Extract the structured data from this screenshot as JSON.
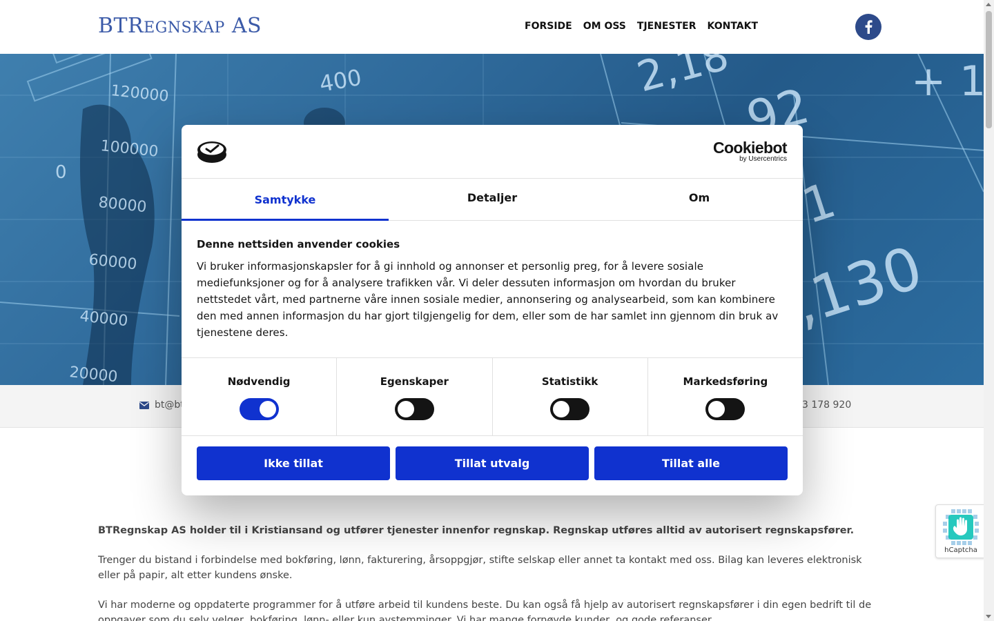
{
  "site": {
    "logo_main": "BTR",
    "logo_small": "EGNSKAP",
    "logo_tail": " AS",
    "nav": [
      "FORSIDE",
      "OM OSS",
      "TJENESTER",
      "KONTAKT"
    ],
    "social_icon": "facebook-icon"
  },
  "hero": {
    "numbers": [
      "120000",
      "100000",
      "80000",
      "60000",
      "40000",
      "20000",
      "400",
      "2,18",
      "92",
      "1,130",
      "51",
      "0",
      "+",
      "1"
    ]
  },
  "contact_bar": {
    "email_fragment": "bt@bt",
    "phone_fragment": "3 178 920"
  },
  "content": {
    "lead": "BTRegnskap AS holder til i Kristiansand og utfører tjenester innenfor regnskap. Regnskap utføres alltid av autorisert regnskapsfører.",
    "p2": "Trenger du bistand i forbindelse med bokføring, lønn, fakturering, årsoppgjør, stifte selskap eller annet ta kontakt med oss. Bilag kan leveres elektronisk eller på papir, alt etter kundens ønske.",
    "p3": "Vi har moderne og oppdaterte programmer for å utføre arbeid til kundens beste. Du kan også få hjelp av autorisert regnskapsfører i din egen bedrift til de oppgaver som du selv velger, bokføring, lønn- eller kun avstemminger. Vi har mange fornøyde kunder, og gode referanser."
  },
  "cookie_dialog": {
    "brand_main": "Cookiebot",
    "brand_sub": "by Usercentrics",
    "tabs": [
      "Samtykke",
      "Detaljer",
      "Om"
    ],
    "active_tab": "Samtykke",
    "title": "Denne nettsiden anvender cookies",
    "text": "Vi bruker informasjonskapsler for å gi innhold og annonser et personlig preg, for å levere sosiale mediefunksjoner og for å analysere trafikken vår. Vi deler dessuten informasjon om hvordan du bruker nettstedet vårt, med partnerne våre innen sosiale medier, annonsering og analysearbeid, som kan kombinere den med annen informasjon du har gjort tilgjengelig for dem, eller som de har samlet inn gjennom din bruk av tjenestene deres.",
    "categories": [
      {
        "label": "Nødvendig",
        "on": true
      },
      {
        "label": "Egenskaper",
        "on": false
      },
      {
        "label": "Statistikk",
        "on": false
      },
      {
        "label": "Markedsføring",
        "on": false
      }
    ],
    "buttons": {
      "deny": "Ikke tillat",
      "selection": "Tillat utvalg",
      "all": "Tillat alle"
    },
    "accent": "#1032cf"
  },
  "hcaptcha": {
    "label": "hCaptcha"
  }
}
